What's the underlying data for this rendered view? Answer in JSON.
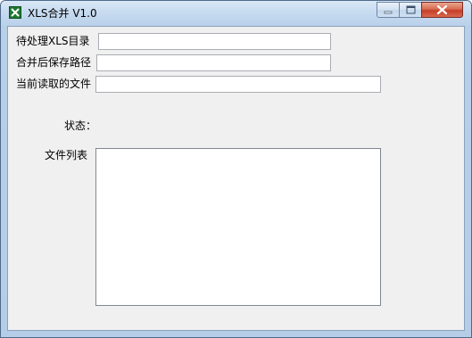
{
  "window": {
    "title": "XLS合并 V1.0",
    "icon": "excel-icon"
  },
  "form": {
    "source_dir_label": "待处理XLS目录",
    "source_dir_value": "",
    "save_path_label": "合并后保存路径",
    "save_path_value": "",
    "current_file_label": "当前读取的文件",
    "current_file_value": "",
    "status_label": "状态：",
    "file_list_label": "文件列表"
  },
  "file_list": {
    "items": []
  },
  "colors": {
    "client_bg": "#f0f0f0",
    "close_button": "#c53e26",
    "title_bar": "#c5daef"
  }
}
